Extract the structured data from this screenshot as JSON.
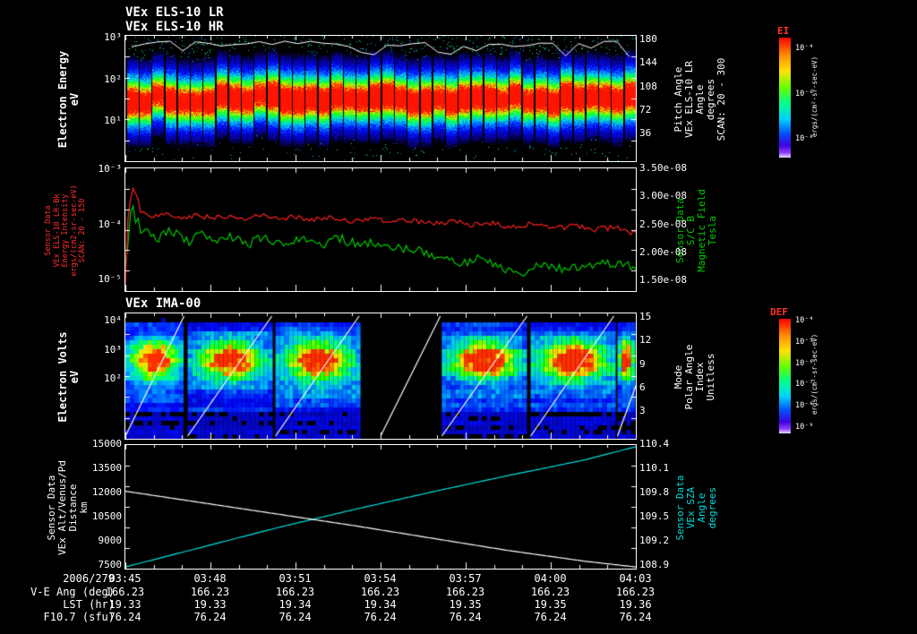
{
  "colors": {
    "background": "#000000",
    "axis": "#ffffff",
    "red_series": "#ff2020",
    "green_series": "#00cc00",
    "cyan_series": "#00e0e0",
    "white_series": "#ffffff"
  },
  "chart_data": [
    {
      "type": "heatmap",
      "name": "ELS electron energy-time spectrogram",
      "title_lines": [
        "VEx ELS-10 LR",
        "VEx ELS-10 HR"
      ],
      "ylabel_lines": [
        "Electron Energy",
        "eV"
      ],
      "y_scale": "log",
      "y_ticks": [
        "10³",
        "10²",
        "10¹"
      ],
      "right_axis": {
        "label_lines": [
          "Pitch Angle",
          "VEx ELS-10 LR",
          "Angle",
          "degrees",
          "SCAN: 20 - 300"
        ],
        "ticks": [
          "180",
          "144",
          "108",
          "72",
          "36"
        ],
        "range": [
          0,
          180
        ]
      },
      "colorbar": {
        "title": "EI",
        "unit": "ergs/(cm²-sr-sec-eV)",
        "ticks": [
          "10⁻⁴",
          "10⁻⁶",
          "10⁻⁸"
        ]
      },
      "x_range": [
        "03:45",
        "04:03"
      ],
      "description": "Intense red band near ~100 eV across whole interval, green/cyan halo, sparse cyan speckles above and below, white max-energy trace along top, ~40 vertical scan columns",
      "heat": {
        "n_scans": 40,
        "band_center_frac": 0.5,
        "band_sigma": 0.08,
        "shoulder_sigma": 0.2
      }
    },
    {
      "type": "line",
      "name": "ELS energy intensity and magnetic field",
      "left_axis": {
        "scale": "log",
        "range": [
          1e-05,
          0.001
        ],
        "ticks": [
          "10⁻³",
          "10⁻⁴",
          "10⁻⁵"
        ],
        "label_lines": [
          "Sensor Data",
          "VEx ELS-10 LR-Bk",
          "Energy Intensity",
          "ergs/(cm2-sr-sec-eV)",
          "SCAN: 20 - 150"
        ]
      },
      "right_axis": {
        "scale": "linear",
        "range": [
          1.5e-08,
          3.5e-08
        ],
        "ticks": [
          "3.50e-08",
          "3.00e-08",
          "2.50e-08",
          "2.00e-08",
          "1.50e-08"
        ],
        "label_lines": [
          "Sensor Data",
          "S/C B",
          "Magnetic Field",
          "Tesla"
        ]
      },
      "series": [
        {
          "name": "ELS energy intensity",
          "color": "#ff2020",
          "axis": "left",
          "units": "ergs/(cm2-sr-sec-eV)",
          "jitter": 0.1,
          "points": [
            [
              0,
              1.2e-05
            ],
            [
              0.015,
              0.00046
            ],
            [
              0.03,
              0.0002
            ],
            [
              0.05,
              0.000155
            ],
            [
              0.08,
              0.000175
            ],
            [
              0.11,
              0.000145
            ],
            [
              0.14,
              0.00018
            ],
            [
              0.17,
              0.00015
            ],
            [
              0.2,
              0.00017
            ],
            [
              0.23,
              0.000145
            ],
            [
              0.26,
              0.000175
            ],
            [
              0.3,
              0.00015
            ],
            [
              0.33,
              0.000165
            ],
            [
              0.36,
              0.00014
            ],
            [
              0.4,
              0.00016
            ],
            [
              0.44,
              0.000135
            ],
            [
              0.48,
              0.000155
            ],
            [
              0.52,
              0.000135
            ],
            [
              0.56,
              0.000145
            ],
            [
              0.6,
              0.000125
            ],
            [
              0.64,
              0.000135
            ],
            [
              0.68,
              0.00012
            ],
            [
              0.72,
              0.00013
            ],
            [
              0.76,
              0.00011
            ],
            [
              0.8,
              0.000125
            ],
            [
              0.84,
              0.000105
            ],
            [
              0.88,
              0.000115
            ],
            [
              0.92,
              0.0001
            ],
            [
              0.96,
              0.00011
            ],
            [
              1,
              8.5e-05
            ]
          ]
        },
        {
          "name": "S/C B magnetic field",
          "color": "#00cc00",
          "axis": "right",
          "units": "T",
          "jitter": 0.035,
          "points": [
            [
              0,
              1.9e-08
            ],
            [
              0.012,
              2.85e-08
            ],
            [
              0.03,
              2.5e-08
            ],
            [
              0.06,
              2.35e-08
            ],
            [
              0.09,
              2.5e-08
            ],
            [
              0.12,
              2.3e-08
            ],
            [
              0.15,
              2.45e-08
            ],
            [
              0.18,
              2.3e-08
            ],
            [
              0.21,
              2.4e-08
            ],
            [
              0.24,
              2.25e-08
            ],
            [
              0.27,
              2.4e-08
            ],
            [
              0.3,
              2.3e-08
            ],
            [
              0.34,
              2.35e-08
            ],
            [
              0.38,
              2.25e-08
            ],
            [
              0.42,
              2.35e-08
            ],
            [
              0.46,
              2.25e-08
            ],
            [
              0.5,
              2.3e-08
            ],
            [
              0.54,
              2.2e-08
            ],
            [
              0.58,
              2.15e-08
            ],
            [
              0.62,
              2.05e-08
            ],
            [
              0.66,
              1.95e-08
            ],
            [
              0.7,
              2.05e-08
            ],
            [
              0.74,
              1.85e-08
            ],
            [
              0.78,
              1.8e-08
            ],
            [
              0.82,
              1.95e-08
            ],
            [
              0.86,
              1.85e-08
            ],
            [
              0.9,
              1.9e-08
            ],
            [
              0.94,
              1.95e-08
            ],
            [
              1,
              1.9e-08
            ]
          ]
        }
      ]
    },
    {
      "type": "heatmap",
      "name": "IMA ion energy-time spectrogram",
      "title": "VEx IMA-00",
      "ylabel_lines": [
        "Electron Volts",
        "eV"
      ],
      "y_scale": "log",
      "y_ticks": [
        "10⁴",
        "10³",
        "10²"
      ],
      "right_axis": {
        "label_lines": [
          "Mode",
          "Polar Angle",
          "Index",
          "Unitless"
        ],
        "ticks": [
          "15",
          "12",
          "9",
          "6",
          "3"
        ],
        "range": [
          0,
          15
        ]
      },
      "colorbar": {
        "title": "DEF",
        "unit": "ergs/(cm²-sr-sec-eV)",
        "ticks": [
          "10⁻⁴",
          "10⁻⁵",
          "10⁻⁶",
          "10⁻⁷",
          "10⁻⁸",
          "10⁻⁹"
        ]
      },
      "description": "Blocky blue ion spectra with bright red/yellow blob near ~1 keV in each scan block, white diagonal elevation-sweep lines, data gap roughly 03:53-03:57",
      "heat": {
        "blocks": [
          [
            0,
            0.115
          ],
          [
            0.122,
            0.287
          ],
          [
            0.294,
            0.458
          ],
          [
            0.62,
            0.787
          ],
          [
            0.794,
            0.957
          ],
          [
            0.964,
            1
          ]
        ],
        "gap": [
          0.458,
          0.62
        ],
        "blob_y": 0.37,
        "diagonals": [
          [
            0,
            0.115
          ],
          [
            0.122,
            0.287
          ],
          [
            0.294,
            0.458
          ],
          [
            0.5,
            0.617
          ],
          [
            0.62,
            0.787
          ],
          [
            0.794,
            0.957
          ],
          [
            0.964,
            1.05
          ]
        ]
      }
    },
    {
      "type": "line",
      "name": "spacecraft altitude and solar zenith angle",
      "left_axis": {
        "scale": "linear",
        "range": [
          7500,
          15000
        ],
        "ticks": [
          "15000",
          "13500",
          "12000",
          "10500",
          "9000",
          "7500"
        ],
        "label_lines": [
          "Sensor Data",
          "VEx Alt/Venus/Pd",
          "Distance",
          "km"
        ]
      },
      "right_axis": {
        "scale": "linear",
        "range": [
          108.9,
          110.4
        ],
        "ticks": [
          "110.4",
          "110.1",
          "109.8",
          "109.5",
          "109.2",
          "108.9"
        ],
        "label_lines": [
          "Sensor Data",
          "VEx SZA",
          "Angle",
          "degrees"
        ]
      },
      "series": [
        {
          "name": "VEx altitude",
          "color": "#ffffff",
          "axis": "left",
          "units": "km",
          "jitter": 0,
          "points": [
            [
              0,
              12200
            ],
            [
              0.15,
              11500
            ],
            [
              0.3,
              10800
            ],
            [
              0.45,
              10100
            ],
            [
              0.6,
              9350
            ],
            [
              0.75,
              8600
            ],
            [
              0.9,
              7950
            ],
            [
              1,
              7600
            ]
          ]
        },
        {
          "name": "VEx solar zenith angle",
          "color": "#00e0e0",
          "axis": "right",
          "units": "degrees",
          "jitter": 0,
          "points": [
            [
              0,
              108.92
            ],
            [
              0.15,
              109.16
            ],
            [
              0.3,
              109.4
            ],
            [
              0.45,
              109.62
            ],
            [
              0.6,
              109.83
            ],
            [
              0.75,
              110.03
            ],
            [
              0.9,
              110.22
            ],
            [
              1,
              110.38
            ]
          ]
        }
      ]
    }
  ],
  "footer": {
    "date": "2006/279",
    "times": [
      "03:45",
      "03:48",
      "03:51",
      "03:54",
      "03:57",
      "04:00",
      "04:03"
    ],
    "rows": [
      {
        "label": "V-E Ang (deg)",
        "values": [
          "166.23",
          "166.23",
          "166.23",
          "166.23",
          "166.23",
          "166.23",
          "166.23"
        ]
      },
      {
        "label": "LST (hr)",
        "values": [
          "19.33",
          "19.33",
          "19.34",
          "19.34",
          "19.35",
          "19.35",
          "19.36"
        ]
      },
      {
        "label": "F10.7 (sfu)",
        "values": [
          "76.24",
          "76.24",
          "76.24",
          "76.24",
          "76.24",
          "76.24",
          "76.24"
        ]
      }
    ]
  }
}
